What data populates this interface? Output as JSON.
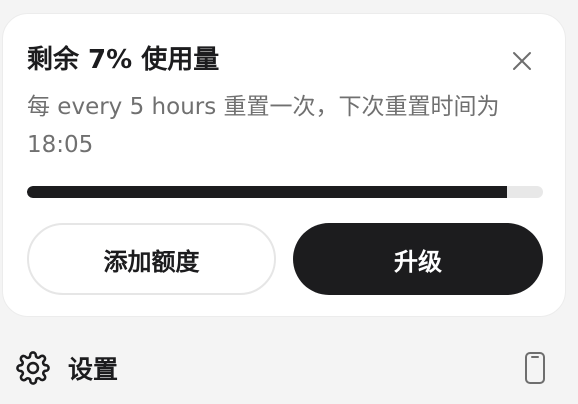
{
  "usage_card": {
    "title": "剩余 7% 使用量",
    "description": "每 every 5 hours 重置一次，下次重置时间为 18:05",
    "progress_fraction": 0.93,
    "add_quota_label": "添加额度",
    "upgrade_label": "升级",
    "close_icon": "close-icon"
  },
  "footer": {
    "settings_label": "设置",
    "settings_icon": "gear-icon",
    "device_icon": "phone-icon"
  },
  "colors": {
    "accent": "#1c1c1e",
    "track": "#e8e8e8",
    "muted_text": "#707070"
  }
}
